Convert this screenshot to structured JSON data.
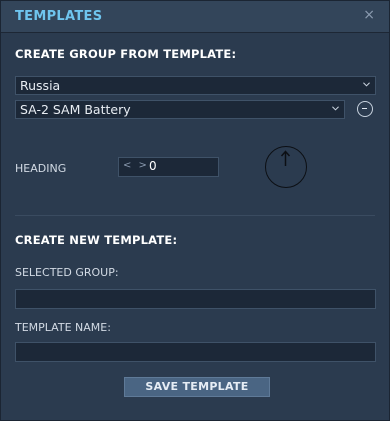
{
  "window": {
    "title": "TEMPLATES",
    "close_glyph": "×"
  },
  "create_from_template": {
    "heading": "CREATE GROUP FROM TEMPLATE:",
    "country": "Russia",
    "template": "SA-2 SAM Battery",
    "heading_label": "HEADING",
    "heading_arrows": "< >",
    "heading_value": "0"
  },
  "create_new": {
    "heading": "CREATE NEW TEMPLATE:",
    "selected_group_label": "SELECTED GROUP:",
    "selected_group_value": "",
    "template_name_label": "TEMPLATE NAME:",
    "template_name_value": "",
    "save_label": "SAVE TEMPLATE"
  },
  "icons": {
    "close": "close-icon",
    "dropdown": "chevron-down-icon",
    "remove": "minus-circle-icon",
    "heading_dial": "compass-dial-icon"
  },
  "colors": {
    "title": "#6fc5ef",
    "background": "#2b3b4f",
    "field": "#1c2838",
    "button": "#4a6583"
  }
}
